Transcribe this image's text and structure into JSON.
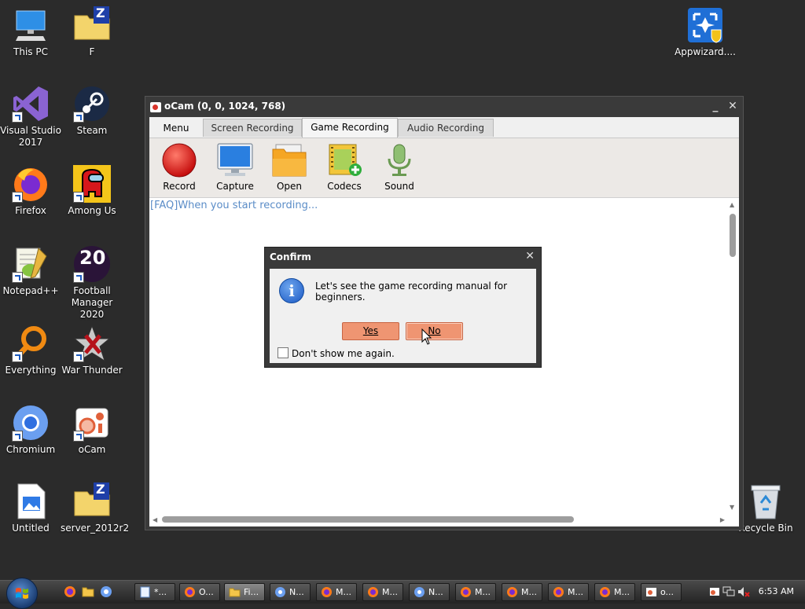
{
  "desktop": {
    "icons": [
      {
        "label": "This PC"
      },
      {
        "label": "F"
      },
      {
        "label": "Visual Studio 2017"
      },
      {
        "label": "Steam"
      },
      {
        "label": "Firefox"
      },
      {
        "label": "Among Us"
      },
      {
        "label": "Notepad++"
      },
      {
        "label": "Football Manager 2020"
      },
      {
        "label": "Everything"
      },
      {
        "label": "War Thunder"
      },
      {
        "label": "Chromium"
      },
      {
        "label": "oCam"
      },
      {
        "label": "Untitled"
      },
      {
        "label": "server_2012r2"
      },
      {
        "label": "Appwizard...."
      },
      {
        "label": "Recycle Bin"
      }
    ],
    "fm_badge": "20",
    "zip_badge": "Z"
  },
  "window": {
    "title": "oCam (0, 0, 1024, 768)",
    "minimize_glyph": "_",
    "close_glyph": "✕"
  },
  "tabs": {
    "menu": "Menu",
    "screen_recording": "Screen Recording",
    "game_recording": "Game Recording",
    "audio_recording": "Audio Recording",
    "active": "Game Recording"
  },
  "toolbar": {
    "record": "Record",
    "capture": "Capture",
    "open": "Open",
    "codecs": "Codecs",
    "sound": "Sound"
  },
  "content": {
    "faq_link": "[FAQ]When you start recording..."
  },
  "dialog": {
    "title": "Confirm",
    "close_glyph": "✕",
    "icon_glyph": "i",
    "message": "Let's see the game recording manual for beginners.",
    "yes_label": "Yes",
    "no_label": "No",
    "dont_show_label": "Don't show me again.",
    "dont_show_checked": false
  },
  "taskbar": {
    "items": [
      {
        "label": "*..."
      },
      {
        "label": "O..."
      },
      {
        "label": "Fi..."
      },
      {
        "label": "N..."
      },
      {
        "label": "M..."
      },
      {
        "label": "M..."
      },
      {
        "label": "N..."
      },
      {
        "label": "M..."
      },
      {
        "label": "M..."
      },
      {
        "label": "M..."
      },
      {
        "label": "M..."
      },
      {
        "label": "o..."
      }
    ],
    "clock": "6:53 AM"
  },
  "colors": {
    "desktop_bg": "#2b2b2b",
    "dialog_button": "#ef9572",
    "link": "#5a8cc7"
  }
}
